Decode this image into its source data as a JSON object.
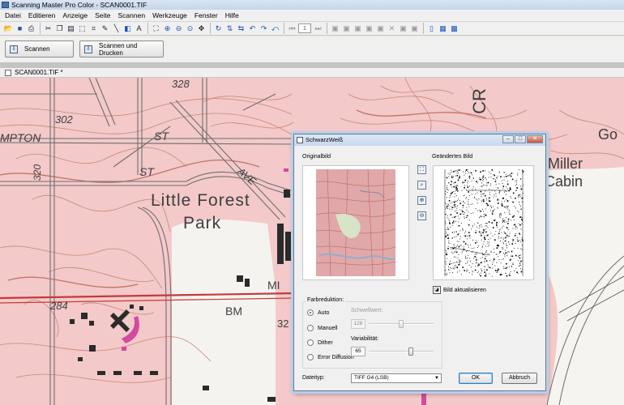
{
  "app": {
    "title": "Scanning Master Pro Color - SCAN0001.TIF"
  },
  "menu": [
    "Datei",
    "Editieren",
    "Anzeige",
    "Seite",
    "Scannen",
    "Werkzeuge",
    "Fenster",
    "Hilfe"
  ],
  "toolbar": {
    "icons": [
      "open-icon",
      "save-icon",
      "print-icon",
      "cut-icon",
      "copy-icon",
      "paste-icon",
      "select-icon",
      "crop-icon",
      "pencil-icon",
      "line-icon",
      "fill-icon",
      "text-icon",
      "fit-icon",
      "zoom-in-icon",
      "zoom-out-icon",
      "zoom-area-icon",
      "pan-icon",
      "rotate-icon",
      "flip-icon",
      "mirror-icon",
      "undo-icon",
      "redo-icon",
      "clear-icon"
    ],
    "page_number": "1",
    "icons_right": [
      "first-page-icon",
      "prev-page-icon",
      "next-page-icon",
      "last-page-icon",
      "add-page-icon",
      "delete-page-icon",
      "page-view-icon",
      "thumbnail-view-icon",
      "grid-view-icon"
    ]
  },
  "actions": {
    "scan": "Scannen",
    "scan_print": "Scannen und Drucken"
  },
  "document_tab": "SCAN0001.TIF *",
  "map": {
    "labels": {
      "n328": "328",
      "n302": "302",
      "mpton": "MPTON",
      "st1": "ST",
      "st2": "ST",
      "ave": "AVE",
      "little_forest": "Little Forest",
      "park": "Park",
      "n320": "320",
      "n284": "284",
      "bm": "BM",
      "mi": "MI",
      "n32": "32",
      "go": "Go",
      "miller": "Miller",
      "cabin": "Cabin",
      "cr": "CR"
    }
  },
  "dialog": {
    "title": "SchwarzWeiß",
    "original_label": "Originalbild",
    "changed_label": "Geändertes Bild",
    "refresh": "Bild aktualisieren",
    "group_title": "Farbreduktion:",
    "radios": [
      "Auto",
      "Manuell",
      "Dither",
      "Error Diffusion"
    ],
    "selected_radio": "Auto",
    "threshold_label": "Schwellwert:",
    "threshold_value": "128",
    "threshold_level": 0.5,
    "variability_label": "Variabilität:",
    "variability_value": "65",
    "variability_level": 0.65,
    "filetype_label": "Dateityp:",
    "filetype_value": "TIFF G4 (LSB)",
    "ok": "OK",
    "cancel": "Abbruch"
  }
}
